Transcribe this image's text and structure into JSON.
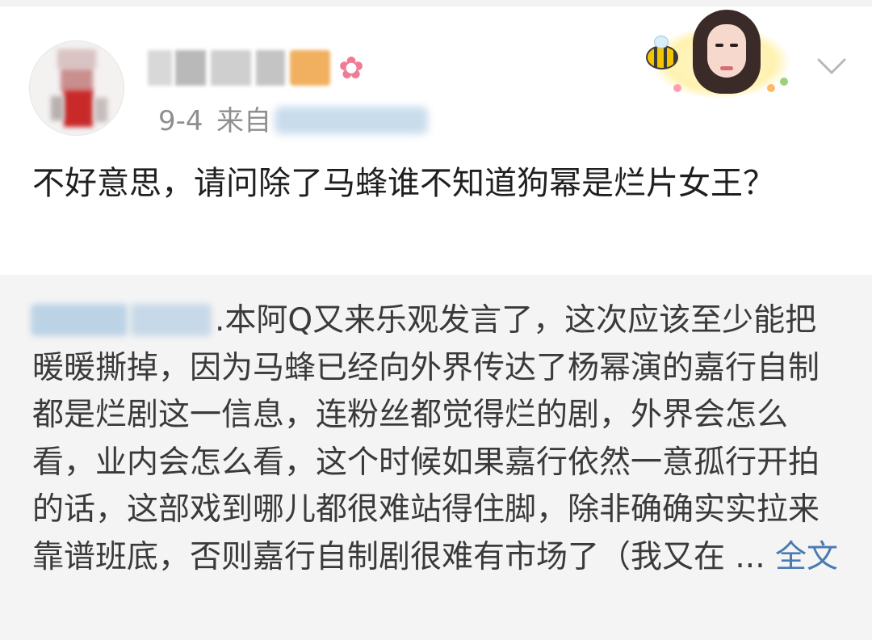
{
  "post": {
    "date": "9-4",
    "from_label": "来自",
    "text": "不好意思，请问除了马蜂谁不知道狗幂是烂片女王？"
  },
  "icons": {
    "flower": "flower-icon",
    "bee": "bee-icon",
    "chevron": "chevron-down-icon"
  },
  "repost": {
    "text": ".本阿Q又来乐观发言了，这次应该至少能把暖暖撕掉，因为马蜂已经向外界传达了杨幂演的嘉行自制都是烂剧这一信息，连粉丝都觉得烂的剧，外界会怎么看，业内会怎么看，这个时候如果嘉行依然一意孤行开拍的话，这部戏到哪儿都很难站得住脚，除非确确实实拉来靠谱班底，否则嘉行自制剧很难有市场了（我又在 ... ",
    "full_text_link": "全文"
  },
  "colors": {
    "link": "#4a7bb0",
    "meta_gray": "#8f8f8f",
    "repost_bg": "#f4f4f4"
  }
}
